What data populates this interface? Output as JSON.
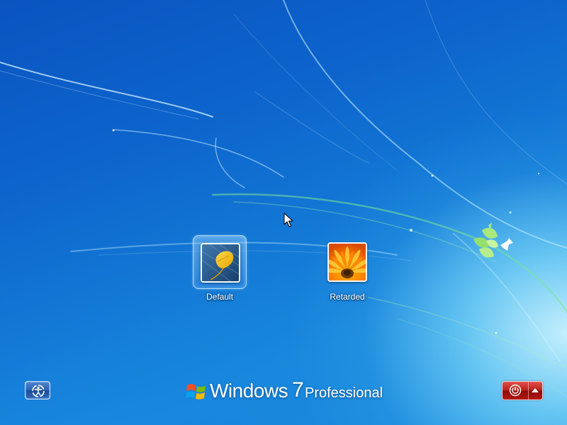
{
  "users": [
    {
      "name": "Default",
      "picture": "leaf-picture",
      "selected": true
    },
    {
      "name": "Retarded",
      "picture": "flower-picture",
      "selected": false
    }
  ],
  "branding": {
    "logo": "windows-flag-logo",
    "word": "Windows",
    "version": "7",
    "edition": "Professional"
  },
  "buttons": {
    "ease_of_access": "ease-of-access-icon",
    "shut_down": "power-icon",
    "shut_down_options": "arrow-up-icon"
  },
  "colors": {
    "background_blue": "#0d64cc",
    "power_red": "#b8211b"
  }
}
